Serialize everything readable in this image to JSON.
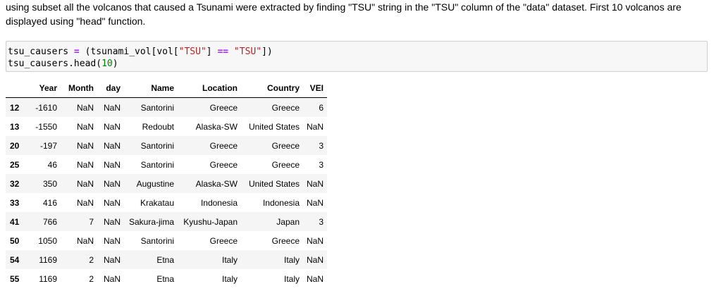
{
  "markdown": {
    "text": "using subset all the volcanos that caused a Tsunami were extracted by finding \"TSU\" string in the \"TSU\" column of the \"data\" dataset. First 10 volcanos are displayed using \"head\" function."
  },
  "code": {
    "line1": {
      "var": "tsu_causers ",
      "eq": "=",
      "mid": " (tsunami_vol[vol[",
      "key": "\"TSU\"",
      "close": "] ",
      "cmp": "==",
      "sp": " ",
      "val": "\"TSU\"",
      "end": "])"
    },
    "line2": {
      "start": "tsu_causers.head(",
      "num": "10",
      "end": ")"
    }
  },
  "table": {
    "columns": [
      "",
      "Year",
      "Month",
      "day",
      "Name",
      "Location",
      "Country",
      "VEI"
    ],
    "rows": [
      {
        "index": "12",
        "Year": "-1610",
        "Month": "NaN",
        "day": "NaN",
        "Name": "Santorini",
        "Location": "Greece",
        "Country": "Greece",
        "VEI": "6"
      },
      {
        "index": "13",
        "Year": "-1550",
        "Month": "NaN",
        "day": "NaN",
        "Name": "Redoubt",
        "Location": "Alaska-SW",
        "Country": "United States",
        "VEI": "NaN"
      },
      {
        "index": "20",
        "Year": "-197",
        "Month": "NaN",
        "day": "NaN",
        "Name": "Santorini",
        "Location": "Greece",
        "Country": "Greece",
        "VEI": "3"
      },
      {
        "index": "25",
        "Year": "46",
        "Month": "NaN",
        "day": "NaN",
        "Name": "Santorini",
        "Location": "Greece",
        "Country": "Greece",
        "VEI": "3"
      },
      {
        "index": "32",
        "Year": "350",
        "Month": "NaN",
        "day": "NaN",
        "Name": "Augustine",
        "Location": "Alaska-SW",
        "Country": "United States",
        "VEI": "NaN"
      },
      {
        "index": "33",
        "Year": "416",
        "Month": "NaN",
        "day": "NaN",
        "Name": "Krakatau",
        "Location": "Indonesia",
        "Country": "Indonesia",
        "VEI": "NaN"
      },
      {
        "index": "41",
        "Year": "766",
        "Month": "7",
        "day": "NaN",
        "Name": "Sakura-jima",
        "Location": "Kyushu-Japan",
        "Country": "Japan",
        "VEI": "3"
      },
      {
        "index": "50",
        "Year": "1050",
        "Month": "NaN",
        "day": "NaN",
        "Name": "Santorini",
        "Location": "Greece",
        "Country": "Greece",
        "VEI": "NaN"
      },
      {
        "index": "54",
        "Year": "1169",
        "Month": "2",
        "day": "NaN",
        "Name": "Etna",
        "Location": "Italy",
        "Country": "Italy",
        "VEI": "NaN"
      },
      {
        "index": "55",
        "Year": "1169",
        "Month": "2",
        "day": "NaN",
        "Name": "Etna",
        "Location": "Italy",
        "Country": "Italy",
        "VEI": "NaN"
      }
    ]
  }
}
